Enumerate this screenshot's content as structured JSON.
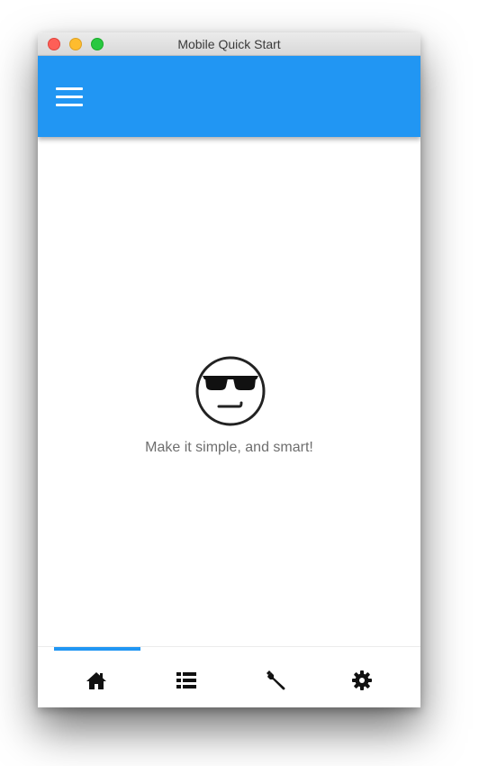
{
  "window": {
    "title": "Mobile Quick Start",
    "controls": [
      "close",
      "minimize",
      "zoom"
    ]
  },
  "app_bar": {
    "color": "#2196f3",
    "menu_icon": "hamburger-menu-icon"
  },
  "main": {
    "hero_icon": "cool-face-sunglasses-icon",
    "tagline": "Make it simple, and smart!"
  },
  "bottom_nav": {
    "active_index": 0,
    "accent_color": "#2196f3",
    "items": [
      {
        "icon": "home-icon"
      },
      {
        "icon": "list-icon"
      },
      {
        "icon": "wrench-icon"
      },
      {
        "icon": "gear-icon"
      }
    ]
  }
}
